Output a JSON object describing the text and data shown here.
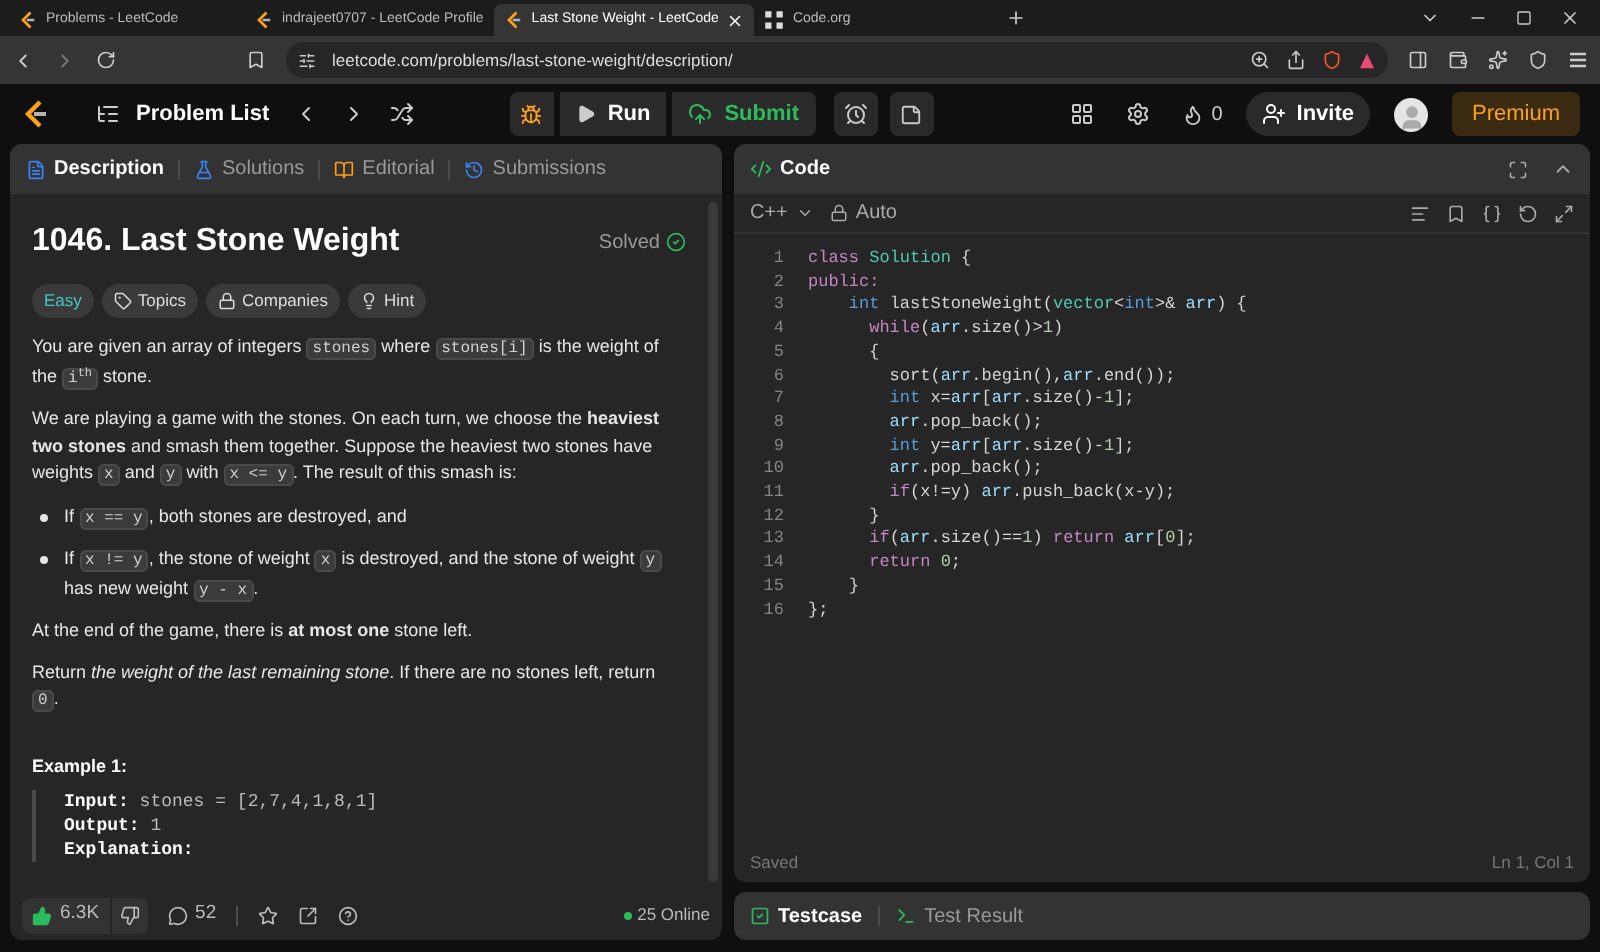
{
  "browser": {
    "tabs": [
      {
        "title": "Problems - LeetCode",
        "kind": "leetcode",
        "selected": false
      },
      {
        "title": "indrajeet0707 - LeetCode Profile",
        "kind": "leetcode",
        "selected": false
      },
      {
        "title": "Last Stone Weight - LeetCode",
        "kind": "leetcode",
        "selected": true
      },
      {
        "title": "Code.org",
        "kind": "codeorg",
        "selected": false
      }
    ],
    "address": "leetcode.com/problems/last-stone-weight/description/"
  },
  "navbar": {
    "problem_list": "Problem List",
    "run": "Run",
    "submit": "Submit",
    "streak": "0",
    "invite": "Invite",
    "premium": "Premium"
  },
  "description_panel": {
    "tabs": [
      {
        "label": "Description",
        "selected": true
      },
      {
        "label": "Solutions",
        "selected": false
      },
      {
        "label": "Editorial",
        "selected": false
      },
      {
        "label": "Submissions",
        "selected": false
      }
    ],
    "title": "1046. Last Stone Weight",
    "status": "Solved",
    "tags": [
      {
        "label": "Easy",
        "kind": "difficulty"
      },
      {
        "label": "Topics",
        "kind": "topics"
      },
      {
        "label": "Companies",
        "kind": "companies"
      },
      {
        "label": "Hint",
        "kind": "hint"
      }
    ],
    "blocks": [
      {
        "kind": "paragraph",
        "segments": [
          {
            "kind": "text",
            "text": "You are given an array of integers "
          },
          {
            "kind": "code",
            "text": "stones"
          },
          {
            "kind": "text",
            "text": " where "
          },
          {
            "kind": "code",
            "text": "stones[i]"
          },
          {
            "kind": "text",
            "text": " is the weight of the "
          },
          {
            "kind": "code",
            "text": "i$^{th}$"
          },
          {
            "kind": "text",
            "text": " stone."
          }
        ]
      },
      {
        "kind": "paragraph",
        "segments": [
          {
            "kind": "text",
            "text": "We are playing a game with the stones. On each turn, we choose the **heaviest two stones** and smash them together. Suppose the heaviest two stones have weights "
          },
          {
            "kind": "code",
            "text": "x"
          },
          {
            "kind": "text",
            "text": " and "
          },
          {
            "kind": "code",
            "text": "y"
          },
          {
            "kind": "text",
            "text": " with "
          },
          {
            "kind": "code",
            "text": "x <= y"
          },
          {
            "kind": "text",
            "text": ". The result of this smash is:"
          }
        ]
      },
      {
        "kind": "bullet",
        "segments": [
          {
            "kind": "text",
            "text": "If "
          },
          {
            "kind": "code",
            "text": "x == y"
          },
          {
            "kind": "text",
            "text": ", both stones are destroyed, and"
          }
        ]
      },
      {
        "kind": "bullet",
        "segments": [
          {
            "kind": "text",
            "text": "If "
          },
          {
            "kind": "code",
            "text": "x != y"
          },
          {
            "kind": "text",
            "text": ", the stone of weight "
          },
          {
            "kind": "code",
            "text": "x"
          },
          {
            "kind": "text",
            "text": " is destroyed, and the stone of weight "
          },
          {
            "kind": "code",
            "text": "y"
          },
          {
            "kind": "text",
            "text": " has new weight "
          },
          {
            "kind": "code",
            "text": "y - x"
          },
          {
            "kind": "text",
            "text": "."
          }
        ]
      },
      {
        "kind": "paragraph",
        "segments": [
          {
            "kind": "text",
            "text": "At the end of the game, there is **at most one** stone left."
          }
        ]
      },
      {
        "kind": "paragraph",
        "segments": [
          {
            "kind": "text",
            "text": "Return *the weight of the last remaining stone*. If there are no stones left, return "
          },
          {
            "kind": "code",
            "text": "0"
          },
          {
            "kind": "text",
            "text": "."
          }
        ]
      },
      {
        "kind": "heading",
        "text": "Example 1:"
      },
      {
        "kind": "example",
        "lines": [
          {
            "label": "Input:",
            "value": "stones = [2,7,4,1,8,1]"
          },
          {
            "label": "Output:",
            "value": "1"
          },
          {
            "label": "Explanation:"
          }
        ]
      }
    ],
    "footer": {
      "likes": "6.3K",
      "comments": "52",
      "online": "25 Online"
    }
  },
  "code_panel": {
    "title": "Code",
    "language": "C++",
    "mode": "Auto",
    "lines": [
      {
        "number": "1",
        "tokens": [
          {
            "kind": "kw",
            "text": "class"
          },
          {
            "kind": "cls",
            "text": " Solution"
          },
          {
            "kind": "plain",
            "text": " {"
          }
        ]
      },
      {
        "number": "2",
        "tokens": [
          {
            "kind": "kw",
            "text": "public:"
          }
        ]
      },
      {
        "number": "3",
        "tokens": [
          {
            "kind": "type",
            "text": "    int"
          },
          {
            "kind": "plain",
            "text": " lastStoneWeight("
          },
          {
            "kind": "cls",
            "text": "vector"
          },
          {
            "kind": "plain",
            "text": "<"
          },
          {
            "kind": "type",
            "text": "int"
          },
          {
            "kind": "plain",
            "text": ">& "
          },
          {
            "kind": "var",
            "text": "arr"
          },
          {
            "kind": "plain",
            "text": ") {"
          }
        ]
      },
      {
        "number": "4",
        "tokens": [
          {
            "kind": "kw",
            "text": "      while"
          },
          {
            "kind": "plain",
            "text": "("
          },
          {
            "kind": "var",
            "text": "arr"
          },
          {
            "kind": "plain",
            "text": ".size()>"
          },
          {
            "kind": "num",
            "text": "1"
          },
          {
            "kind": "plain",
            "text": ")"
          }
        ]
      },
      {
        "number": "5",
        "tokens": [
          {
            "kind": "plain",
            "text": "      {"
          }
        ]
      },
      {
        "number": "6",
        "tokens": [
          {
            "kind": "plain",
            "text": "        sort("
          },
          {
            "kind": "var",
            "text": "arr"
          },
          {
            "kind": "plain",
            "text": ".begin(),"
          },
          {
            "kind": "var",
            "text": "arr"
          },
          {
            "kind": "plain",
            "text": ".end());"
          }
        ]
      },
      {
        "number": "7",
        "tokens": [
          {
            "kind": "type",
            "text": "        int"
          },
          {
            "kind": "plain",
            "text": " x="
          },
          {
            "kind": "var",
            "text": "arr"
          },
          {
            "kind": "plain",
            "text": "["
          },
          {
            "kind": "var",
            "text": "arr"
          },
          {
            "kind": "plain",
            "text": ".size()-"
          },
          {
            "kind": "num",
            "text": "1"
          },
          {
            "kind": "plain",
            "text": "];"
          }
        ]
      },
      {
        "number": "8",
        "tokens": [
          {
            "kind": "var",
            "text": "        arr"
          },
          {
            "kind": "plain",
            "text": ".pop_back();"
          }
        ]
      },
      {
        "number": "9",
        "tokens": [
          {
            "kind": "type",
            "text": "        int"
          },
          {
            "kind": "plain",
            "text": " y="
          },
          {
            "kind": "var",
            "text": "arr"
          },
          {
            "kind": "plain",
            "text": "["
          },
          {
            "kind": "var",
            "text": "arr"
          },
          {
            "kind": "plain",
            "text": ".size()-"
          },
          {
            "kind": "num",
            "text": "1"
          },
          {
            "kind": "plain",
            "text": "];"
          }
        ]
      },
      {
        "number": "10",
        "tokens": [
          {
            "kind": "var",
            "text": "        arr"
          },
          {
            "kind": "plain",
            "text": ".pop_back();"
          }
        ]
      },
      {
        "number": "11",
        "tokens": [
          {
            "kind": "kw",
            "text": "        if"
          },
          {
            "kind": "plain",
            "text": "(x!=y) "
          },
          {
            "kind": "var",
            "text": "arr"
          },
          {
            "kind": "plain",
            "text": ".push_back(x-y);"
          }
        ]
      },
      {
        "number": "12",
        "tokens": [
          {
            "kind": "plain",
            "text": "      }"
          }
        ]
      },
      {
        "number": "13",
        "tokens": [
          {
            "kind": "kw",
            "text": "      if"
          },
          {
            "kind": "plain",
            "text": "("
          },
          {
            "kind": "var",
            "text": "arr"
          },
          {
            "kind": "plain",
            "text": ".size()=="
          },
          {
            "kind": "num",
            "text": "1"
          },
          {
            "kind": "plain",
            "text": ") "
          },
          {
            "kind": "kw",
            "text": "return"
          },
          {
            "kind": "var",
            "text": " arr"
          },
          {
            "kind": "plain",
            "text": "["
          },
          {
            "kind": "num",
            "text": "0"
          },
          {
            "kind": "plain",
            "text": "];"
          }
        ]
      },
      {
        "number": "14",
        "tokens": [
          {
            "kind": "kw",
            "text": "      return"
          },
          {
            "kind": "num",
            "text": " 0"
          },
          {
            "kind": "plain",
            "text": ";"
          }
        ]
      },
      {
        "number": "15",
        "tokens": [
          {
            "kind": "plain",
            "text": "    }"
          }
        ]
      },
      {
        "number": "16",
        "tokens": [
          {
            "kind": "plain",
            "text": "};"
          }
        ]
      }
    ],
    "status": "Saved",
    "cursor": "Ln 1, Col 1"
  },
  "console_panel": {
    "tabs": [
      {
        "label": "Testcase",
        "selected": true
      },
      {
        "label": "Test Result",
        "selected": false
      }
    ]
  }
}
